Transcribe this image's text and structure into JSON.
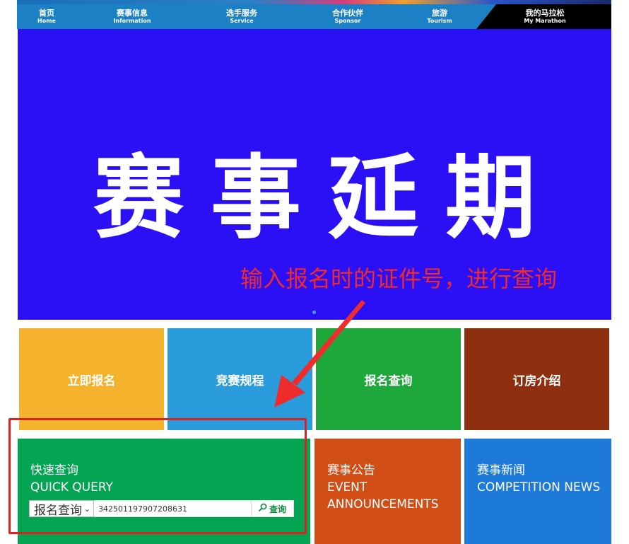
{
  "nav": {
    "items": [
      {
        "zh": "首页",
        "en": "Home"
      },
      {
        "zh": "赛事信息",
        "en": "Information"
      },
      {
        "zh": "选手服务",
        "en": "Service"
      },
      {
        "zh": "合作伙伴",
        "en": "Sponsor"
      },
      {
        "zh": "旅游",
        "en": "Tourism"
      }
    ],
    "my": {
      "zh": "我的马拉松",
      "en": "My Marathon"
    }
  },
  "banner": {
    "title": "赛事延期",
    "background_color": "#2b0ff5"
  },
  "annotation": {
    "text": "输入报名时的证件号，进行查询",
    "color": "#f02a2a"
  },
  "tiles": [
    {
      "label": "立即报名",
      "color": "#f5b22c"
    },
    {
      "label": "竞赛规程",
      "color": "#2a9bdb"
    },
    {
      "label": "报名查询",
      "color": "#1ea83c"
    },
    {
      "label": "订房介绍",
      "color": "#8e3010"
    }
  ],
  "quick_query": {
    "title_zh": "快速查询",
    "title_en": "QUICK QUERY",
    "select_value": "报名查询",
    "input_value": "342501197907208631",
    "button_label": "查询",
    "color": "#03a552"
  },
  "announcements": {
    "title_zh": "赛事公告",
    "title_en_1": "EVENT",
    "title_en_2": "ANNOUNCEMENTS",
    "color": "#d14e17"
  },
  "news": {
    "title_zh": "赛事新闻",
    "title_en": "COMPETITION NEWS",
    "color": "#1e7ad8"
  }
}
